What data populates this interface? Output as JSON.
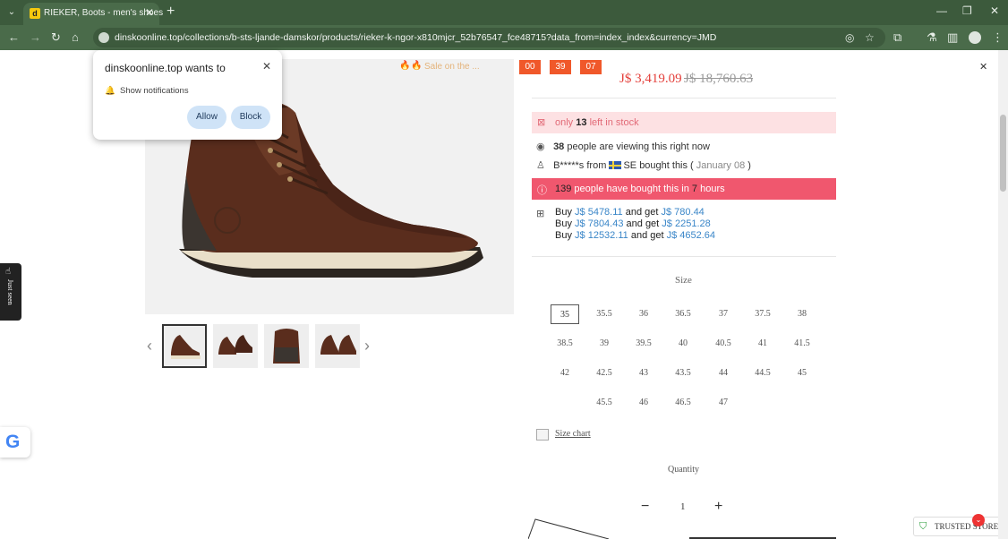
{
  "browser": {
    "tab_title": "RIEKER, Boots - men's shoes",
    "tab_favicon": "d",
    "url": "dinskoonline.top/collections/b-sts-ljande-damskor/products/rieker-k-ngor-x810mjcr_52b76547_fce48715?data_from=index_index&currency=JMD",
    "icons": [
      "tab-list-icon",
      "close-tab-icon",
      "new-tab-icon",
      "minimize-icon",
      "restore-icon",
      "close-window-icon",
      "back-icon",
      "forward-icon",
      "reload-icon",
      "home-icon",
      "site-info-icon",
      "eye-off-icon",
      "star-icon",
      "extensions-icon",
      "lab-icon",
      "side-panel-icon",
      "profile-icon",
      "menu-icon"
    ]
  },
  "permission_popup": {
    "title": "dinskoonline.top wants to",
    "permission": "Show notifications",
    "allow_label": "Allow",
    "block_label": "Block"
  },
  "countdown": {
    "promo_text": "Sale on the ...",
    "hours": "00",
    "minutes": "39",
    "seconds": "07"
  },
  "price": {
    "current": "J$ 3,419.09",
    "original": "J$ 18,760.63"
  },
  "stock": {
    "prefix": "only",
    "count": "13",
    "suffix": "left in stock"
  },
  "viewing": {
    "count": "38",
    "text": "people are viewing this right now"
  },
  "recent_purchase": {
    "buyer": "B*****s",
    "from": "from",
    "country": "SE",
    "action": "bought this (",
    "date": "January 08",
    "close_paren": ")"
  },
  "bought": {
    "count": "139",
    "middle": "people have bought this in",
    "hours": "7",
    "suffix": "hours"
  },
  "offers": [
    {
      "buy_label": "Buy",
      "buy_amount": "J$ 5478.11",
      "get_label": "and get",
      "get_amount": "J$ 780.44"
    },
    {
      "buy_label": "Buy",
      "buy_amount": "J$ 7804.43",
      "get_label": "and get",
      "get_amount": "J$ 2251.28"
    },
    {
      "buy_label": "Buy",
      "buy_amount": "J$ 12532.11",
      "get_label": "and get",
      "get_amount": "J$ 4652.64"
    }
  ],
  "size": {
    "title": "Size",
    "selected": "35",
    "options": [
      "35",
      "35.5",
      "36",
      "36.5",
      "37",
      "37.5",
      "38",
      "38.5",
      "39",
      "39.5",
      "40",
      "40.5",
      "41",
      "41.5",
      "42",
      "42.5",
      "43",
      "43.5",
      "44",
      "44.5",
      "45",
      "45.5",
      "46",
      "46.5",
      "47"
    ]
  },
  "size_chart_label": "Size chart",
  "quantity": {
    "title": "Quantity",
    "value": "1",
    "minus": "−",
    "plus": "+"
  },
  "just_seen_label": "Just seen",
  "google_badge_letter": "G",
  "trusted_store_label": "TRUSTED STORE",
  "colors": {
    "chrome_dark": "#3c5a3c",
    "chrome": "#4a6b4a",
    "countdown": "#f0582a",
    "price": "#e4413c",
    "stock_bg": "#fde1e3",
    "bought_bg": "#f0576e",
    "offer_amount": "#3a86c8"
  }
}
